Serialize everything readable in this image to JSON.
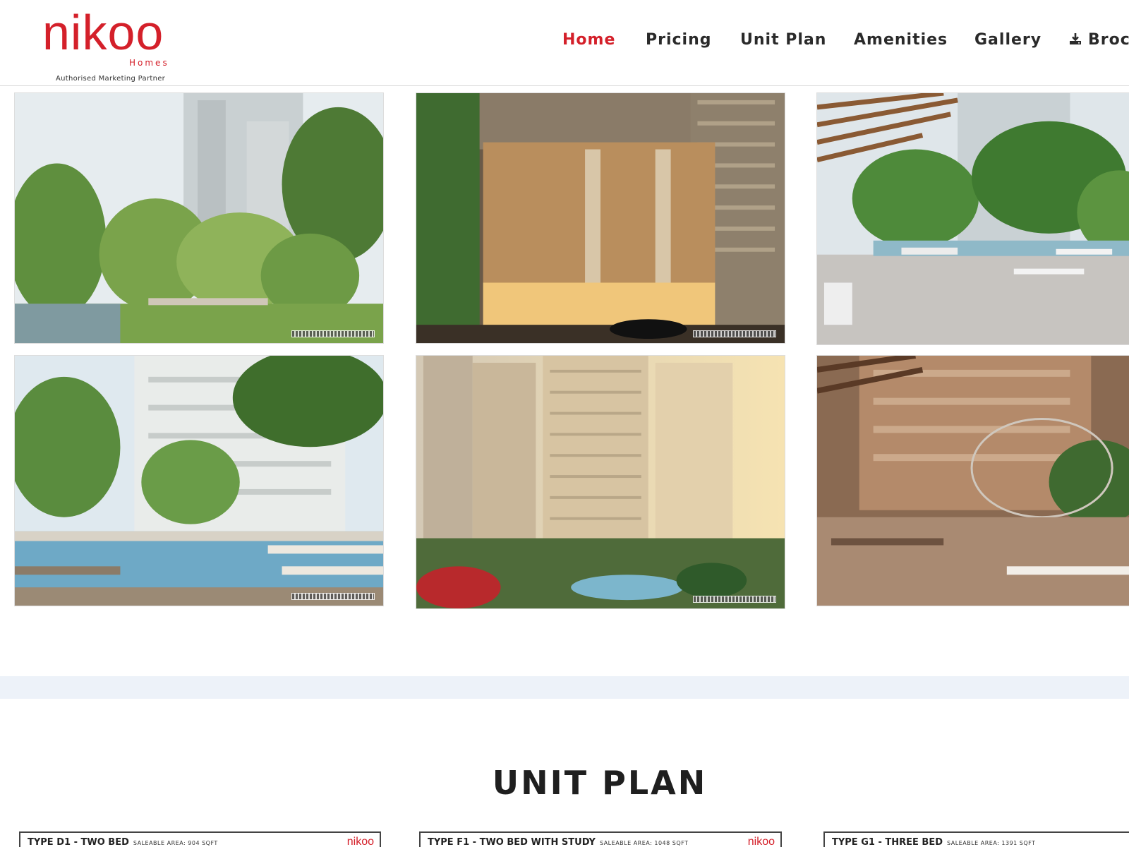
{
  "brand": {
    "name": "nikoo",
    "sub": "Homes",
    "tagline": "Authorised Marketing Partner",
    "color": "#d4202a"
  },
  "nav": {
    "items": [
      {
        "label": "Home",
        "active": true
      },
      {
        "label": "Pricing"
      },
      {
        "label": "Unit Plan"
      },
      {
        "label": "Amenities"
      },
      {
        "label": "Gallery"
      },
      {
        "label": "Broc",
        "icon": "download-icon"
      }
    ]
  },
  "gallery": {
    "images": [
      {
        "scene": "riverside-park"
      },
      {
        "scene": "tower-lobby-facade"
      },
      {
        "scene": "pergola-terrace"
      },
      {
        "scene": "swimming-pool"
      },
      {
        "scene": "tower-skyline"
      },
      {
        "scene": "outdoor-dining"
      }
    ]
  },
  "unit_plan": {
    "title": "UNIT PLAN",
    "cards": [
      {
        "title": "TYPE D1 - TWO BED",
        "area": "SALEABLE AREA: 904 SQFT",
        "logo": "nikoo"
      },
      {
        "title": "TYPE F1 - TWO BED WITH STUDY",
        "area": "SALEABLE AREA: 1048 SQFT",
        "logo": "nikoo"
      },
      {
        "title": "TYPE G1 - THREE BED",
        "area": "SALEABLE AREA: 1391 SQFT",
        "logo": ""
      }
    ]
  }
}
